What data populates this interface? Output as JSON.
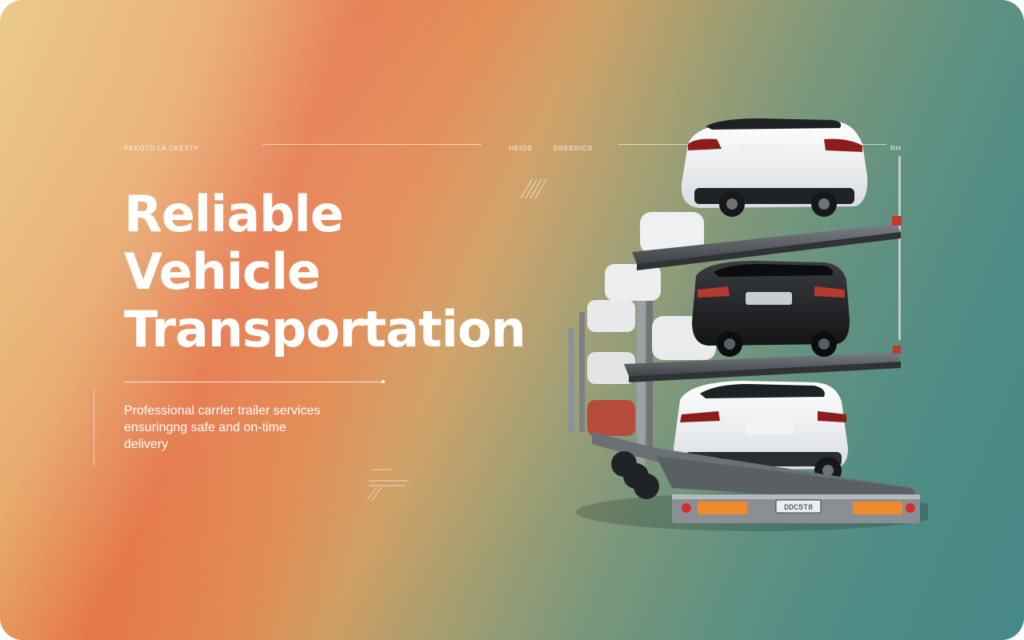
{
  "nav": {
    "brand": "PEKOTO LA CKESTY",
    "links": [
      "HEIOS",
      "DREERICS"
    ],
    "end": "RH"
  },
  "hero": {
    "title_lines": [
      "Reliable",
      "Vehicle",
      "Transportation"
    ],
    "subtitle_lines": [
      "Professional carrler trailer services",
      "ensuringng  safe and on-time",
      "delivery"
    ]
  },
  "trailer": {
    "plate": "DDC5T8"
  },
  "colors": {
    "gradient_sand": "#e9c680",
    "gradient_orange": "#e57648",
    "gradient_teal": "#468888",
    "text": "#ffffff",
    "trailer_light": "#f08a2c",
    "tail_light": "#d32f2f"
  }
}
